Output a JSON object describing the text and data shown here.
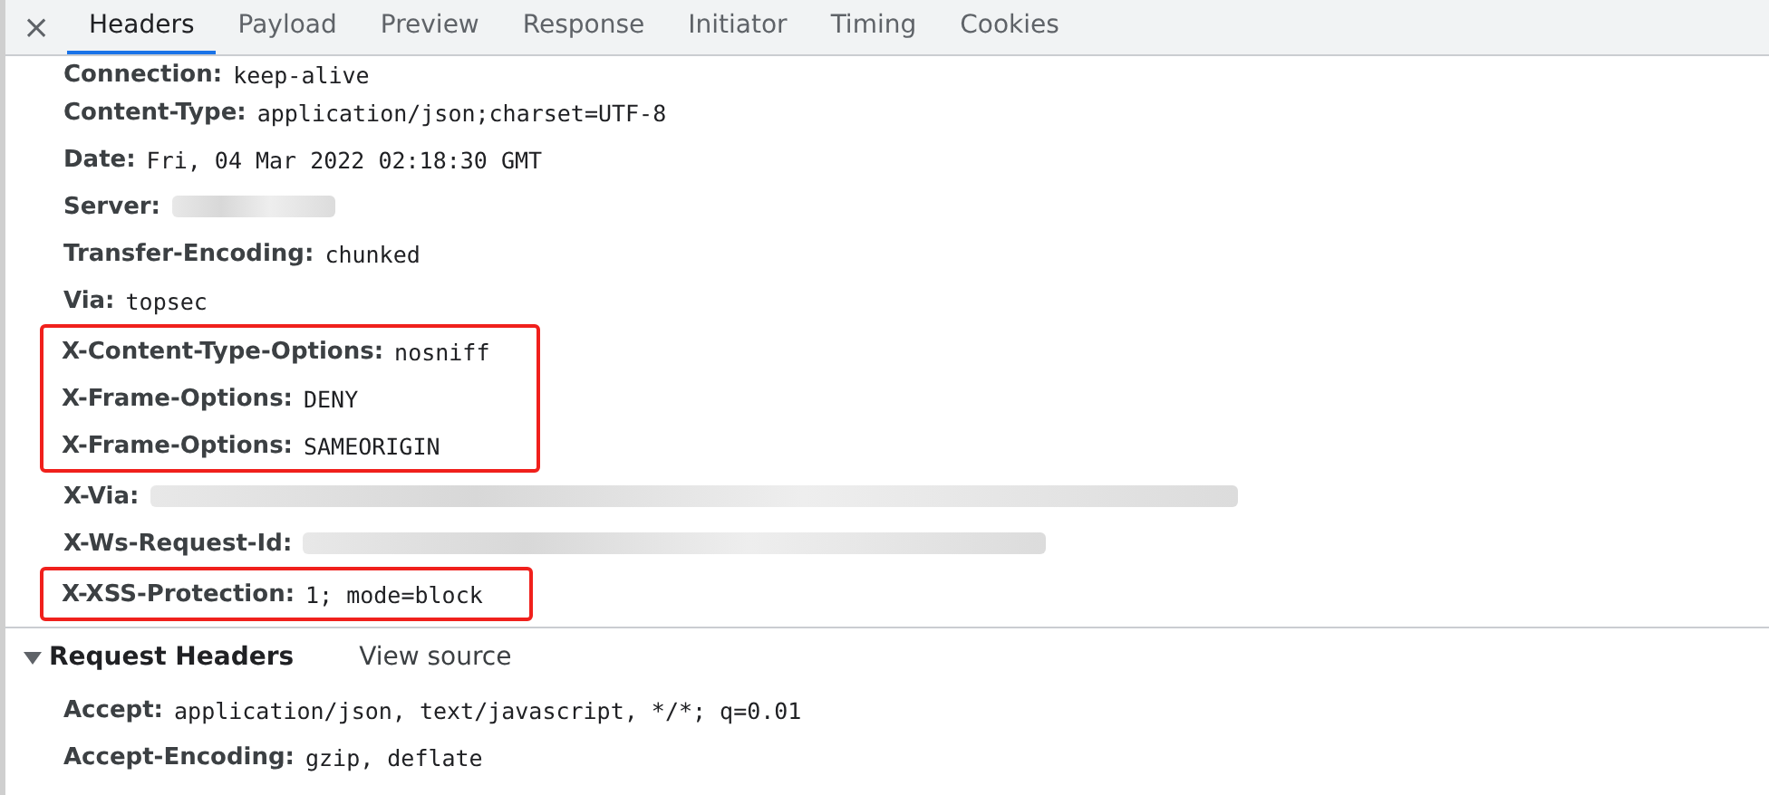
{
  "close_label": "×",
  "tabs": [
    {
      "label": "Headers",
      "selected": true
    },
    {
      "label": "Payload",
      "selected": false
    },
    {
      "label": "Preview",
      "selected": false
    },
    {
      "label": "Response",
      "selected": false
    },
    {
      "label": "Initiator",
      "selected": false
    },
    {
      "label": "Timing",
      "selected": false
    },
    {
      "label": "Cookies",
      "selected": false
    }
  ],
  "response_headers": [
    {
      "name": "Connection:",
      "value": "keep-alive",
      "redacted": false,
      "highlighted": false
    },
    {
      "name": "Content-Type:",
      "value": "application/json;charset=UTF-8",
      "redacted": false,
      "highlighted": false
    },
    {
      "name": "Date:",
      "value": "Fri, 04 Mar 2022 02:18:30 GMT",
      "redacted": false,
      "highlighted": false
    },
    {
      "name": "Server:",
      "redacted": true,
      "highlighted": false
    },
    {
      "name": "Transfer-Encoding:",
      "value": "chunked",
      "redacted": false,
      "highlighted": false
    },
    {
      "name": "Via:",
      "value": "topsec",
      "redacted": false,
      "highlighted": false
    },
    {
      "name": "X-Content-Type-Options:",
      "value": "nosniff",
      "redacted": false,
      "highlighted": true
    },
    {
      "name": "X-Frame-Options:",
      "value": "DENY",
      "redacted": false,
      "highlighted": true
    },
    {
      "name": "X-Frame-Options:",
      "value": "SAMEORIGIN",
      "redacted": false,
      "highlighted": true
    },
    {
      "name": "X-Via:",
      "redacted": true,
      "highlighted": false
    },
    {
      "name": "X-Ws-Request-Id:",
      "redacted": true,
      "highlighted": false
    },
    {
      "name": "X-XSS-Protection:",
      "value": "1; mode=block",
      "redacted": false,
      "highlighted": true
    }
  ],
  "request_section": {
    "title": "Request Headers",
    "expanded": true,
    "link": "View source"
  },
  "request_headers": [
    {
      "name": "Accept:",
      "value": "application/json, text/javascript, */*; q=0.01"
    },
    {
      "name": "Accept-Encoding:",
      "value": "gzip, deflate"
    }
  ]
}
